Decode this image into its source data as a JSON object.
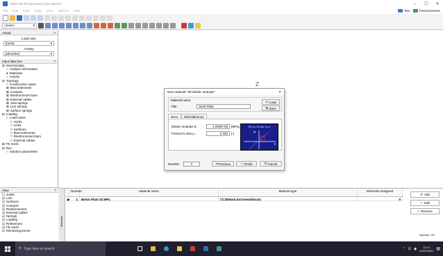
{
  "window": {
    "title": "Atena 3D Pre-processor [Ato varner*]",
    "minimize": "–",
    "maximize": "☐",
    "close": "✕"
  },
  "menu": {
    "items": [
      "File",
      "Edit",
      "Input",
      "Data",
      "View",
      "Options",
      "Help"
    ],
    "run_label": "Run",
    "post_label": "Post-processor"
  },
  "toolbar": {
    "combo_value": "<none>",
    "icons": [
      "new-icon",
      "open-icon",
      "save-icon",
      "cut-icon",
      "copy-icon",
      "paste-icon",
      "undo-icon",
      "redo-icon"
    ]
  },
  "left_panel": {
    "actual_header": "Actual",
    "pin": "?",
    "load_case_label": "Load case",
    "load_case_value": "[none]",
    "activity_label": "Activity",
    "activity_value": "[all active]",
    "input_tree_header": "Input data tree",
    "tree": [
      {
        "label": "General data",
        "level": 0,
        "mark": "⊟"
      },
      {
        "label": "Analysis information",
        "level": 1,
        "mark": "○"
      },
      {
        "label": "Materials",
        "level": 1,
        "mark": "●"
      },
      {
        "label": "Activity",
        "level": 1,
        "mark": "○"
      },
      {
        "label": "Topology",
        "level": 0,
        "mark": "⊟"
      },
      {
        "label": "Construction cases",
        "level": 1,
        "mark": "○"
      },
      {
        "label": "Macroelements",
        "level": 1,
        "mark": "⊞"
      },
      {
        "label": "Contacts",
        "level": 1,
        "mark": "⊞"
      },
      {
        "label": "Reinforcement bars",
        "level": 1,
        "mark": "⊞"
      },
      {
        "label": "External cables",
        "level": 1,
        "mark": "⊞"
      },
      {
        "label": "Joint springs",
        "level": 1,
        "mark": "⊞"
      },
      {
        "label": "Line springs",
        "level": 1,
        "mark": "⊞"
      },
      {
        "label": "Surface springs",
        "level": 1,
        "mark": "⊞"
      },
      {
        "label": "Loading",
        "level": 0,
        "mark": "⊟"
      },
      {
        "label": "Load cases",
        "level": 1,
        "mark": "○"
      },
      {
        "label": "Joints",
        "level": 2,
        "mark": "□"
      },
      {
        "label": "Lines",
        "level": 2,
        "mark": "□"
      },
      {
        "label": "Surfaces",
        "level": 2,
        "mark": "□"
      },
      {
        "label": "Macroelements",
        "level": 2,
        "mark": "□"
      },
      {
        "label": "Reinforcement bars",
        "level": 2,
        "mark": "□"
      },
      {
        "label": "External cables",
        "level": 2,
        "mark": "□"
      },
      {
        "label": "FE mesh",
        "level": 0,
        "mark": "⊞"
      },
      {
        "label": "Run",
        "level": 0,
        "mark": "⊟"
      },
      {
        "label": "Solution parameters",
        "level": 1,
        "mark": "○"
      }
    ],
    "view_header": "View",
    "view_items": [
      "Joints",
      "Line",
      "Surfaces",
      "Contacts",
      "Reinforcement",
      "External cables",
      "Springs",
      "Loading",
      "Refinement",
      "FE mesh",
      "Monitoring points"
    ],
    "view_checked": [
      false,
      true,
      true,
      true,
      true,
      true,
      true,
      true,
      true,
      true,
      true
    ]
  },
  "canvas": {
    "axis_label": "Z"
  },
  "dialog": {
    "title": "New material \"3D Elastic Isotropic\"",
    "close": "✕",
    "material_name_label": "Material name",
    "title_label": "Title:",
    "title_value": "Steel Plate",
    "load_label": "Load",
    "save_label": "Save",
    "tabs": [
      "Basic",
      "Miscellaneous"
    ],
    "elastic_modulus_label": "Elastic modulus E :",
    "elastic_modulus_value": "2.000E+05",
    "elastic_modulus_unit": "[MPa]",
    "poisson_label": "Poisson's ratio μ :",
    "poisson_value": "0.300",
    "poisson_unit": "[-]",
    "graph_title": "Stress-Strain Law",
    "graph_sigma": "σ",
    "graph_eps": "ε",
    "graph_e": "E",
    "number_label": "Number:",
    "number_value": "2",
    "previous_label": "Previous",
    "finish_label": "Finish",
    "cancel_label": "Cancel"
  },
  "materials_table": {
    "side_label": "Materials",
    "headers": [
      "Number",
      "Material name",
      "Material type",
      "Elements assigned"
    ],
    "rows": [
      {
        "indicator": "▶",
        "number": "1",
        "name": "Beton Plate 20 MPa",
        "type": "CC3DNonLinCementitious2",
        "assigned": "0"
      }
    ],
    "add_label": "Add",
    "edit_label": "Edit",
    "remove_label": "Remove",
    "number_info": "Number: 0/1"
  },
  "taskbar": {
    "search_placeholder": "Type here to search",
    "time": "13:11",
    "date": "04/07/2021"
  },
  "colors": {
    "accent_blue": "#2a6ebb",
    "graph_bg": "#1a1e8a",
    "taskbar": "#1f1f2e"
  }
}
